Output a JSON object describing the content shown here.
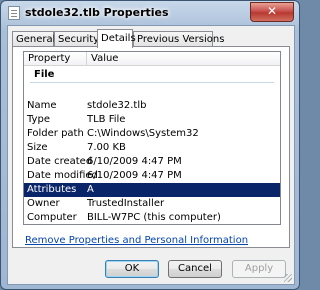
{
  "window": {
    "title": "stdole32.tlb Properties",
    "close_glyph": "✕"
  },
  "tabs": [
    "General",
    "Security",
    "Details",
    "Previous Versions"
  ],
  "active_tab": "Details",
  "columns": {
    "property": "Property",
    "value": "Value"
  },
  "group_label": "File",
  "rows": [
    {
      "key": "Name",
      "value": "stdole32.tlb"
    },
    {
      "key": "Type",
      "value": "TLB File"
    },
    {
      "key": "Folder path",
      "value": "C:\\Windows\\System32"
    },
    {
      "key": "Size",
      "value": "7.00 KB"
    },
    {
      "key": "Date created",
      "value": "6/10/2009 4:47 PM"
    },
    {
      "key": "Date modified",
      "value": "6/10/2009 4:47 PM"
    },
    {
      "key": "Attributes",
      "value": "A"
    },
    {
      "key": "Owner",
      "value": "TrustedInstaller"
    },
    {
      "key": "Computer",
      "value": "BILL-W7PC (this computer)"
    }
  ],
  "selected_row": "Attributes",
  "remove_link": "Remove Properties and Personal Information",
  "buttons": {
    "ok": "OK",
    "cancel": "Cancel",
    "apply": "Apply"
  },
  "colors": {
    "selection": "#0a246a",
    "link": "#0645ad",
    "close": "#c75050"
  }
}
